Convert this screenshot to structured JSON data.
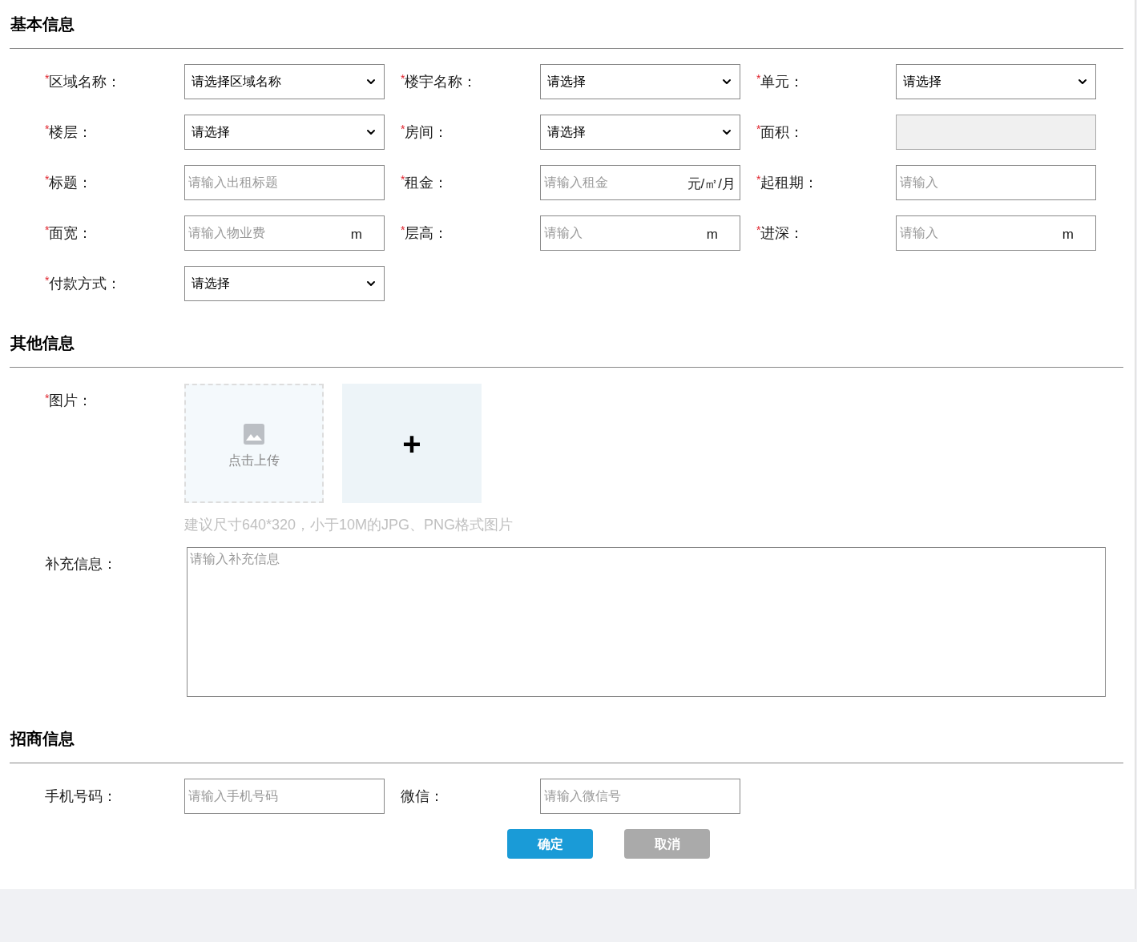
{
  "sections": [
    {
      "title": "基本信息",
      "kind": "grid",
      "fields": [
        {
          "label": "区域名称：",
          "mark": "*",
          "kind": "select",
          "value": "请选择区域名称"
        },
        {
          "label": "楼宇名称：",
          "mark": "*",
          "kind": "select",
          "value": "请选择"
        },
        {
          "label": "单元：",
          "mark": "*",
          "kind": "select",
          "value": "请选择"
        },
        {
          "label": "楼层：",
          "mark": "*",
          "kind": "select",
          "value": "请选择"
        },
        {
          "label": "房间：",
          "mark": "*",
          "kind": "select",
          "value": "请选择"
        },
        {
          "label": "面积：",
          "mark": "*",
          "kind": "disabled"
        },
        {
          "label": "标题：",
          "mark": "*",
          "kind": "input",
          "placeholder": "请输入出租标题"
        },
        {
          "label": "租金：",
          "mark": "*",
          "kind": "input",
          "placeholder": "请输入租金",
          "unit": "元/㎡/月"
        },
        {
          "label": "起租期：",
          "mark": "*",
          "kind": "input",
          "placeholder": "请输入"
        },
        {
          "label": "面宽：",
          "mark": "*",
          "kind": "input",
          "placeholder": "请输入物业费",
          "unit": "m"
        },
        {
          "label": "层高：",
          "mark": "*",
          "kind": "input",
          "placeholder": "请输入",
          "unit": "m"
        },
        {
          "label": "进深：",
          "mark": "*",
          "kind": "input",
          "placeholder": "请输入",
          "unit": "m"
        },
        {
          "label": "付款方式：",
          "mark": "*",
          "kind": "select",
          "value": "请选择"
        }
      ]
    },
    {
      "title": "其他信息",
      "kind": "other",
      "image": {
        "label": "图片：",
        "mark": "*",
        "upload_text": "点击上传",
        "add_label": "+",
        "hint": "建议尺寸640*320，小于10M的JPG、PNG格式图片"
      },
      "notes": {
        "label": "补充信息：",
        "placeholder": "请输入补充信息"
      }
    },
    {
      "title": "招商信息",
      "kind": "grid",
      "fields": [
        {
          "label": "手机号码：",
          "kind": "input",
          "placeholder": "请输入手机号码"
        },
        {
          "label": "微信：",
          "kind": "input",
          "placeholder": "请输入微信号"
        }
      ]
    }
  ],
  "buttons": [
    {
      "label": "确定",
      "kind": "primary"
    },
    {
      "label": "取消",
      "kind": "secondary"
    }
  ]
}
